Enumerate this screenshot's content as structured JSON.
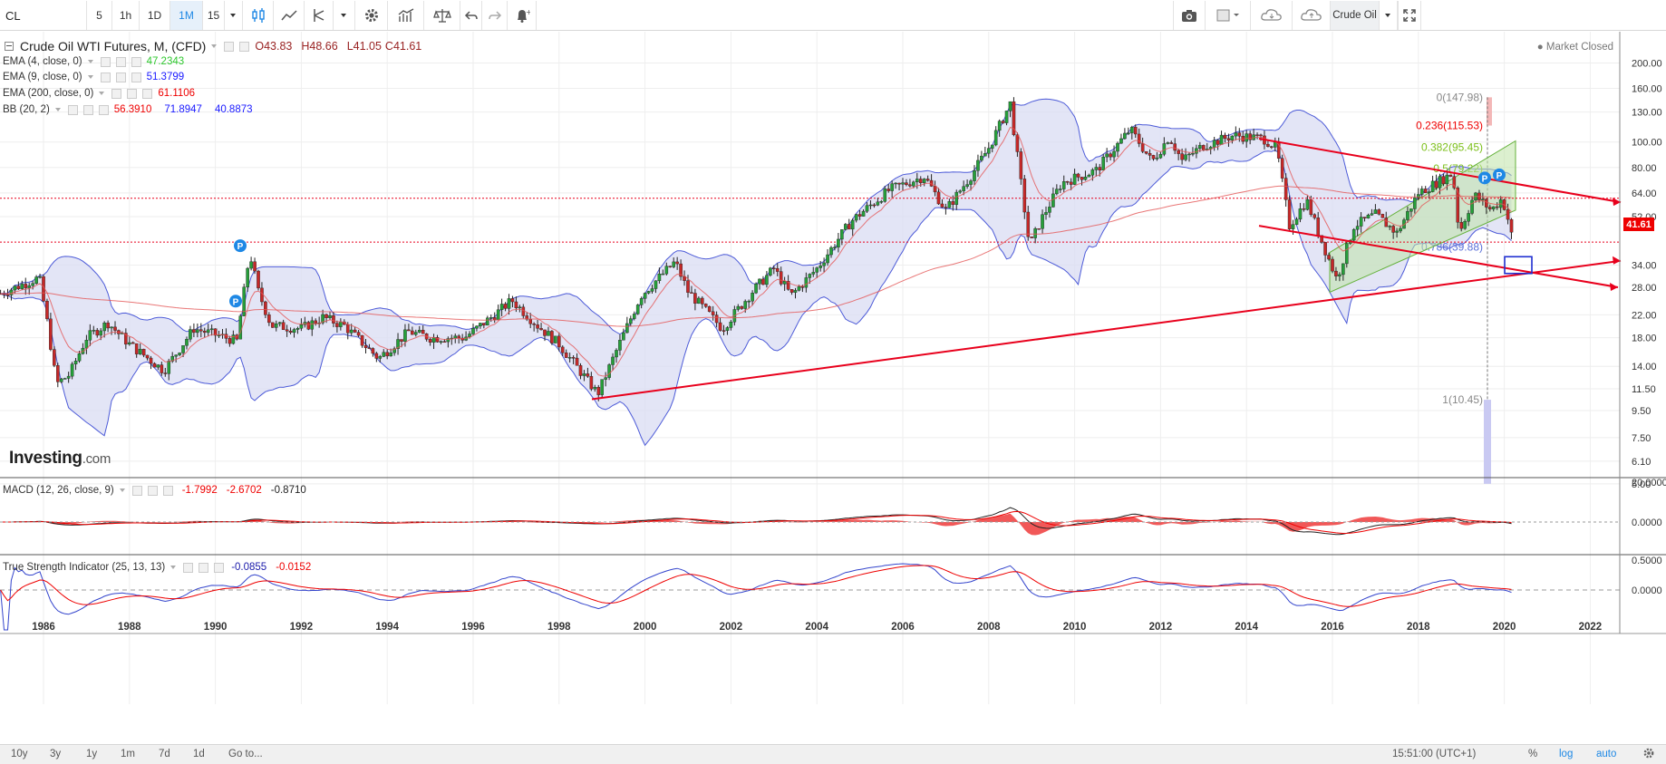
{
  "toolbar": {
    "symbol": "CL",
    "intervals": [
      "5",
      "1h",
      "1D",
      "1M",
      "15"
    ],
    "active_interval": "1M",
    "right_label": "Crude Oil"
  },
  "legend": {
    "title": "Crude Oil WTI Futures, M, (CFD)",
    "ohlc": {
      "o": "O43.83",
      "h": "H48.66",
      "l": "L41.05",
      "c": "C41.61"
    },
    "ema4": {
      "label": "EMA (4, close, 0)",
      "value": "47.2343"
    },
    "ema9": {
      "label": "EMA (9, close, 0)",
      "value": "51.3799"
    },
    "ema200": {
      "label": "EMA (200, close, 0)",
      "value": "61.1106"
    },
    "bb": {
      "label": "BB (20, 2)",
      "v1": "56.3910",
      "v2": "71.8947",
      "v3": "40.8873"
    },
    "market_status": "Market Closed"
  },
  "brand": {
    "main": "Investing",
    "suffix": ".com"
  },
  "price_axis": {
    "labels": [
      "200.00",
      "160.00",
      "130.00",
      "100.00",
      "80.00",
      "64.00",
      "52.00",
      "41.61",
      "34.00",
      "28.00",
      "22.00",
      "18.00",
      "14.00",
      "11.50",
      "9.50",
      "7.50",
      "6.10",
      "5.00"
    ],
    "current_price": "41.61"
  },
  "fib_labels": [
    "0(147.98)",
    "0.236(115.53)",
    "0.382(95.45)",
    "0.5(79.22)",
    "0.786(39.88)",
    "1(10.45)"
  ],
  "pins": [
    "P",
    "P",
    "P",
    "P"
  ],
  "macd": {
    "label": "MACD (12, 26, close, 9)",
    "v1": "-1.7992",
    "v2": "-2.6702",
    "v3": "-0.8710",
    "axis": [
      "20.0000",
      "0.0000"
    ]
  },
  "tsi": {
    "label": "True Strength Indicator (25, 13, 13)",
    "v1": "-0.0855",
    "v2": "-0.0152",
    "axis": [
      "0.5000",
      "0.0000"
    ]
  },
  "time_axis": [
    "1986",
    "1988",
    "1990",
    "1992",
    "1994",
    "1996",
    "1998",
    "2000",
    "2002",
    "2004",
    "2006",
    "2008",
    "2010",
    "2012",
    "2014",
    "2016",
    "2018",
    "2020",
    "2022"
  ],
  "bottombar": {
    "ranges": [
      "10y",
      "3y",
      "1y",
      "1m",
      "7d",
      "1d"
    ],
    "goto": "Go to...",
    "time": "15:51:00 (UTC+1)",
    "percent": "%",
    "log": "log",
    "auto": "auto"
  },
  "colors": {
    "up": "#26a03a",
    "down": "#c62828",
    "accent": "#1e88e5",
    "trendline": "#e8001c",
    "bb_fill": "#d9dcf3",
    "bb_line": "#4d5bd8"
  }
}
